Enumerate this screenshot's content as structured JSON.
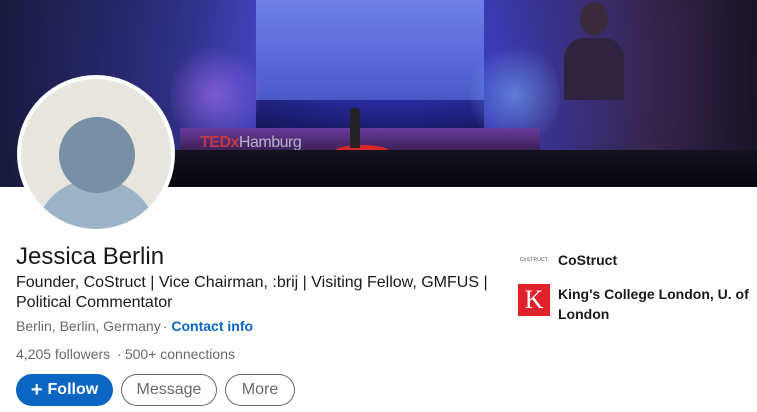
{
  "banner": {
    "stage_logo": "TEDx",
    "stage_logo_suffix": "Hamburg"
  },
  "profile": {
    "name": "Jessica Berlin",
    "headline": "Founder, CoStruct | Vice Chairman, :brij | Visiting Fellow, GMFUS | Political Commentator",
    "location": "Berlin, Berlin, Germany",
    "separator": "·",
    "contact_info": "Contact info",
    "followers": "4,205 followers",
    "connections": "500+ connections"
  },
  "actions": {
    "follow": "Follow",
    "follow_icon": "+",
    "message": "Message",
    "more": "More"
  },
  "organizations": [
    {
      "name": "CoStruct",
      "logo_text": "CoSTRUCT",
      "icon": "costruct-logo"
    },
    {
      "name": "King's College London, U. of London",
      "logo_text": "K",
      "icon": "kcl-logo"
    }
  ],
  "colors": {
    "primary": "#0a66c2",
    "kcl_red": "#e0202a",
    "costruct_red": "#d62828"
  }
}
